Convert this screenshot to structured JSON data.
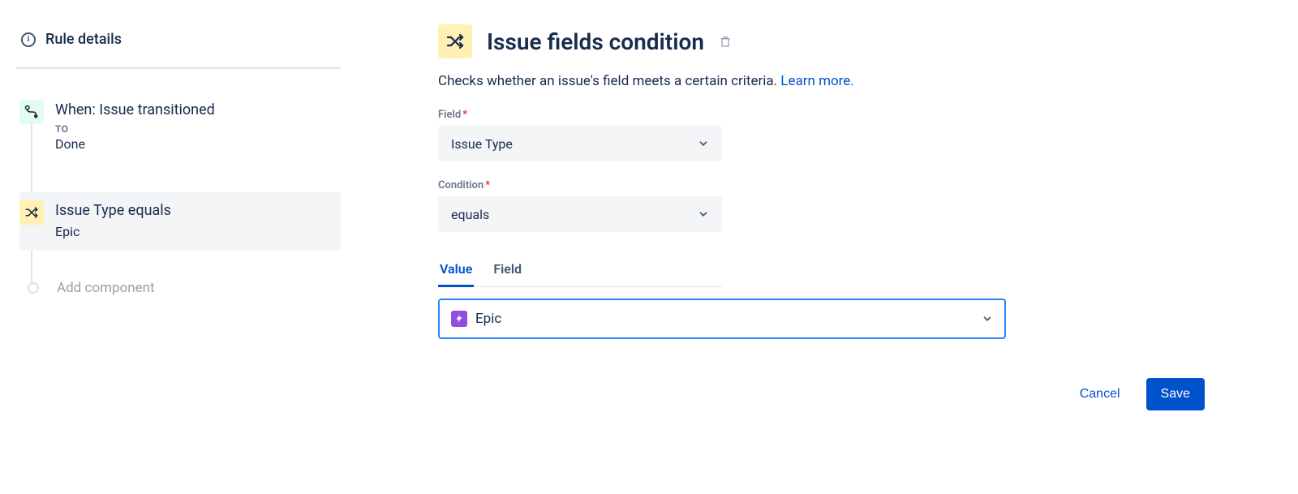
{
  "sidebar": {
    "header": "Rule details",
    "trigger": {
      "title": "When: Issue transitioned",
      "to_label": "TO",
      "to_value": "Done"
    },
    "condition": {
      "title": "Issue Type equals",
      "detail": "Epic"
    },
    "add_component": "Add component"
  },
  "main": {
    "title": "Issue fields condition",
    "description": "Checks whether an issue's field meets a certain criteria. ",
    "learn_more": "Learn more.",
    "field_label": "Field",
    "field_value": "Issue Type",
    "condition_label": "Condition",
    "condition_value": "equals",
    "tabs": {
      "value": "Value",
      "field": "Field"
    },
    "value_selected": "Epic",
    "buttons": {
      "cancel": "Cancel",
      "save": "Save"
    }
  }
}
